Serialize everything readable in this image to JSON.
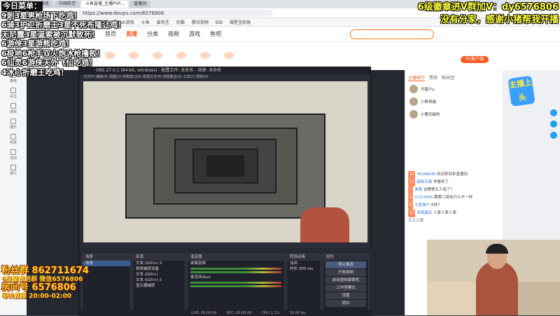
{
  "browser": {
    "tabs": [
      "上网导航",
      "中国科学",
      "斗鱼直播_主播PVP...",
      "直播间"
    ],
    "url": "https://www.douyu.com/6576806",
    "bookmarks": [
      "谷歌",
      "百度",
      "Flash游戏",
      "斗鱼",
      "爱奇艺",
      "优酷",
      "腾讯视频",
      "B站",
      "福星宝妖猴"
    ]
  },
  "site": {
    "nav": [
      "首页",
      "直播",
      "分类",
      "视频",
      "游戏",
      "鱼吧"
    ],
    "search_placeholder": "",
    "pc_button": "PC客户端"
  },
  "leftnav": {
    "items": [
      "推荐",
      "关注",
      "游戏",
      "娱乐",
      "科技",
      "活动",
      "排行"
    ]
  },
  "overlay": {
    "menu": [
      "今日菜单：",
      "9刺3星男枪场下吃鸡！",
      "6骑3护卫折磨王3星不死布隆让鸡！",
      "无尼露3星诞索被沉默致死！",
      "6游侠3星游熊吃鸡！",
      "6极地6枪手双火炮冰枪撸败！",
      "6仙灵6游侠天外飞仙吃鸡！",
      "4冰心折磨王吃鸡！"
    ],
    "right": [
      "6级徽章进V群加V：dy6576806",
      "没有分家，感谢小猪帮我开播"
    ],
    "bottom": {
      "group": "粉丝群 862711674",
      "note": "6级徽章进群 微信6576806",
      "room": "房间号 6576806",
      "time": "每晚直播 20:00-02:00"
    }
  },
  "obs": {
    "title": "OBS 27.0.1 (64-bit, windows) - 配置文件: 未命名 - 场景: 未命名",
    "menu": "文件(F)  编辑(E)  视图(V)  停靠窗口(D)  配置文件(P)  场景集合(S)  工具(T)  帮助(H)",
    "docks": {
      "scenes_header": "场景",
      "scenes": [
        "场景"
      ],
      "sources_header": "来源",
      "sources": [
        "文本 (GDI+) 3",
        "视频捕获设备",
        "文本 (GDI+)",
        "文本 (GDI+) 2",
        "显示器捕获"
      ],
      "mixer_header": "混音器",
      "mixer": [
        "桌面音频",
        "麦克风/Aux"
      ],
      "transitions_header": "转场动画",
      "transitions": [
        "淡出",
        "时长 300 ms"
      ],
      "controls_header": "控件",
      "controls": [
        "停止推流",
        "开始录制",
        "启动虚拟摄像机",
        "工作室模式",
        "设置",
        "退出"
      ]
    },
    "status": [
      "LIVE: 00:00:00",
      "REC: 00:00:00",
      "CPU: 1.1%",
      "30.00 fps"
    ]
  },
  "rightpanel": {
    "tabs": [
      "主播排行",
      "贵宾",
      "粉丝团"
    ],
    "ranks": [
      "天星小y",
      "小胖卓越",
      "小猪无敌的"
    ],
    "chat": [
      {
        "level": "12",
        "name": "WUANXIN",
        "text": "欢迎来到本直播间"
      },
      {
        "level": "12",
        "name": "超级无敌",
        "text": "你看到了"
      },
      {
        "level": "7",
        "name": "游客",
        "text": "这赛季五人组了？"
      },
      {
        "level": "6",
        "name": "tc123456",
        "text": "跟第二局有什么不一样"
      },
      {
        "level": "8",
        "name": "斗鱼用户",
        "text": "8进7"
      },
      {
        "level": "12",
        "name": "本局最后",
        "text": "人家人家人家"
      }
    ],
    "follow_label": "关注主播"
  },
  "badge": {
    "text": "主播上头"
  },
  "colors": {
    "brand": "#ff5d23",
    "overlay_yellow": "#ffff3c",
    "obs_bg": "#2b2e38"
  }
}
